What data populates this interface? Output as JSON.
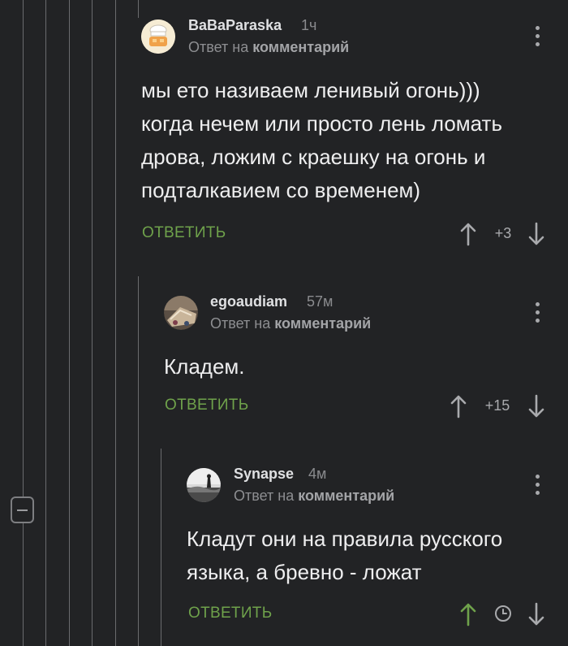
{
  "comments": [
    {
      "author": "BaBaParaska",
      "time": "1ч",
      "reply_prefix": "Ответ на",
      "reply_target": "комментарий",
      "lines": [
        "мы ето називаем ленивый огонь)))",
        "когда нечем или просто лень ломать",
        "дрова, ложим с краешку на огонь и",
        "подталкавием со временем)"
      ],
      "reply_label": "ОТВЕТИТЬ",
      "rating": "+3",
      "avatar_icon": "chef-avatar",
      "upvoted": false
    },
    {
      "author": "egoaudiam",
      "time": "57м",
      "reply_prefix": "Ответ на",
      "reply_target": "комментарий",
      "lines": [
        "Кладем."
      ],
      "reply_label": "ОТВЕТИТЬ",
      "rating": "+15",
      "avatar_icon": "photo-avatar",
      "upvoted": false
    },
    {
      "author": "Synapse",
      "time": "4м",
      "reply_prefix": "Ответ на",
      "reply_target": "комментарий",
      "lines": [
        "Кладут они на правила русского",
        "языка, а бревно - ложат"
      ],
      "reply_label": "ОТВЕТИТЬ",
      "rating_icon": "clock-icon",
      "avatar_icon": "photo-avatar",
      "upvoted": true
    }
  ],
  "colors": {
    "background": "#222325",
    "accent_green": "#6fa24b",
    "thread_line": "#6a6b6e"
  }
}
